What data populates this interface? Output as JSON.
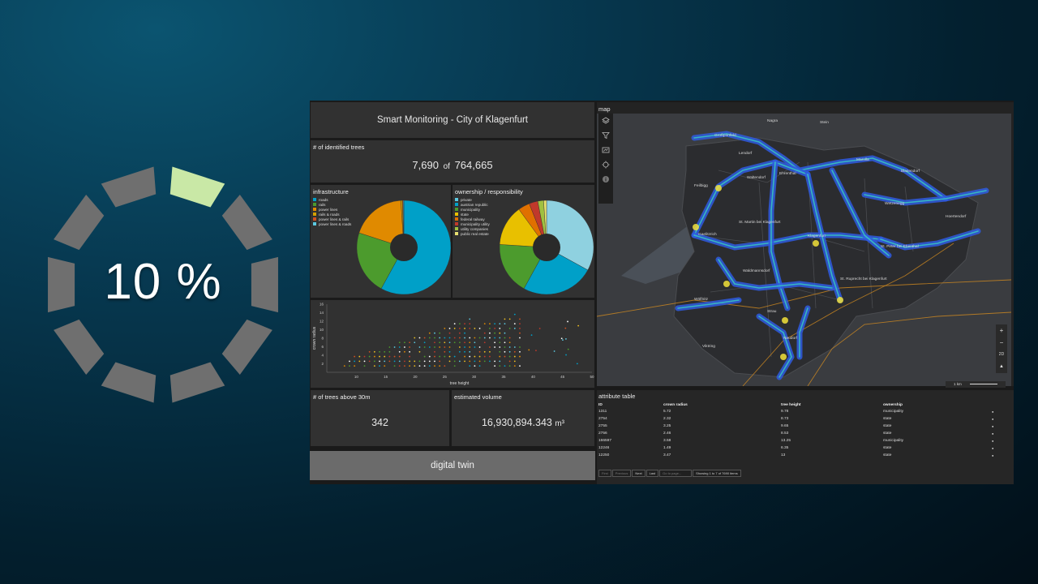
{
  "progress": {
    "label": "10 %",
    "fraction": 0.1,
    "active_color": "#c9e8a6",
    "inactive_color": "#6f6f6f"
  },
  "dashboard": {
    "title": "Smart Monitoring - City of Klagenfurt",
    "identified": {
      "label": "# of identified trees",
      "count": "7,690",
      "of_word": "of",
      "total": "764,665"
    },
    "infrastructure": {
      "title": "infrastructure",
      "legend": [
        {
          "label": "roads",
          "color": "#00a0c8"
        },
        {
          "label": "rails",
          "color": "#4c9b2d"
        },
        {
          "label": "power lines",
          "color": "#e08a00"
        },
        {
          "label": "rails & roads",
          "color": "#d4a000"
        },
        {
          "label": "power lines & rails",
          "color": "#d05020"
        },
        {
          "label": "power lines & roads",
          "color": "#5cc8e0"
        }
      ]
    },
    "ownership": {
      "title": "ownership / responsibility",
      "legend": [
        {
          "label": "private",
          "color": "#5cc8e0"
        },
        {
          "label": "austrian republic",
          "color": "#00a0c8"
        },
        {
          "label": "municipality",
          "color": "#4c9b2d"
        },
        {
          "label": "state",
          "color": "#e8c000"
        },
        {
          "label": "federal railway",
          "color": "#e07000"
        },
        {
          "label": "municipality utility",
          "color": "#c0392b"
        },
        {
          "label": "utility companies",
          "color": "#a0c040"
        },
        {
          "label": "public real estate",
          "color": "#e8e070"
        }
      ]
    },
    "above30": {
      "label": "# of trees above 30m",
      "value": "342"
    },
    "volume": {
      "label": "estimated volume",
      "value": "16,930,894.343",
      "unit": "m³"
    },
    "twin_button": "digital twin",
    "map": {
      "title": "map",
      "tools": [
        "layers-icon",
        "filter-icon",
        "legend-icon",
        "locate-icon",
        "info-icon"
      ],
      "places": [
        "Nagra",
        "Stein",
        "Großponfeld",
        "Lendorf",
        "Marolla",
        "Blasendorf",
        "Waltendorf",
        "Ehrenthal",
        "Feilbigg",
        "Wetzenegg",
        "Hoertendorf",
        "St. Martin bei Klagenfurt",
        "Klagenfurt",
        "Gaelitzrich",
        "St. Peter bei Ebenthal",
        "Waldmannsdorf",
        "St. Ruprecht bei Klagenfurt",
        "Wölfnitz",
        "Strau",
        "Viktring",
        "Neudorf"
      ],
      "zoom": {
        "in": "+",
        "out": "−",
        "mode": "2D",
        "north": "▲"
      },
      "scale": "1 km"
    },
    "attribute_table": {
      "title": "attribute table",
      "columns": [
        "ID",
        "crown radius",
        "tree height",
        "ownership"
      ],
      "rows": [
        [
          "1311",
          "5.72",
          "9.78",
          "municipality"
        ],
        [
          "2754",
          "2.32",
          "8.73",
          "state"
        ],
        [
          "2755",
          "3.25",
          "9.65",
          "state"
        ],
        [
          "2756",
          "2.46",
          "8.53",
          "state"
        ],
        [
          "166597",
          "3.58",
          "13.25",
          "municipality"
        ],
        [
          "12246",
          "1.49",
          "6.35",
          "state"
        ],
        [
          "12250",
          "3.47",
          "13",
          "state"
        ]
      ],
      "pager": {
        "first": "First",
        "previous": "Previous",
        "next": "Next",
        "last": "Last",
        "goto_placeholder": "Go to page...",
        "summary": "Showing 1 to 7 of 7690 items"
      }
    }
  },
  "chart_data": [
    {
      "type": "pie",
      "title": "infrastructure",
      "categories": [
        "roads",
        "rails",
        "power lines",
        "rails & roads",
        "power lines & rails",
        "power lines & roads"
      ],
      "values": [
        58,
        22,
        19,
        0.5,
        0.25,
        0.25
      ],
      "colors": [
        "#00a0c8",
        "#4c9b2d",
        "#e08a00",
        "#d4a000",
        "#d05020",
        "#5cc8e0"
      ]
    },
    {
      "type": "pie",
      "title": "ownership / responsibility",
      "categories": [
        "private",
        "austrian republic",
        "municipality",
        "state",
        "federal railway",
        "municipality utility",
        "utility companies",
        "public real estate"
      ],
      "values": [
        33,
        25,
        18,
        14,
        4,
        3,
        2,
        1
      ],
      "colors": [
        "#8fd1e0",
        "#00a0c8",
        "#4c9b2d",
        "#e8c000",
        "#e07000",
        "#c0392b",
        "#a0c040",
        "#e8e070"
      ]
    },
    {
      "type": "scatter",
      "xlabel": "tree height",
      "ylabel": "crown radius",
      "xlim": [
        5,
        50
      ],
      "ylim": [
        0,
        16
      ],
      "xticks": [
        10,
        15,
        20,
        25,
        30,
        35,
        40,
        45,
        50
      ],
      "yticks": [
        2,
        4,
        6,
        8,
        10,
        12,
        14,
        16
      ],
      "grid": false
    }
  ]
}
